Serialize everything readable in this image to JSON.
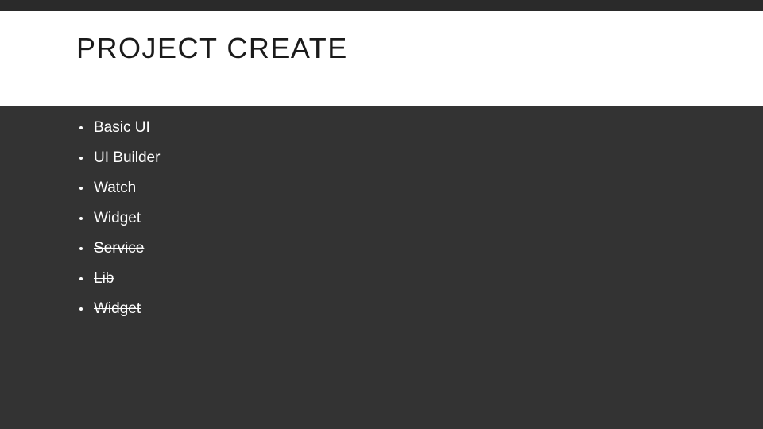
{
  "title": "PROJECT CREATE",
  "bullets": {
    "b0": "Basic UI",
    "b1": "UI Builder",
    "b2": "Watch",
    "b3": "Widget",
    "b4": "Service",
    "b5": "Lib",
    "b6": "Widget"
  }
}
